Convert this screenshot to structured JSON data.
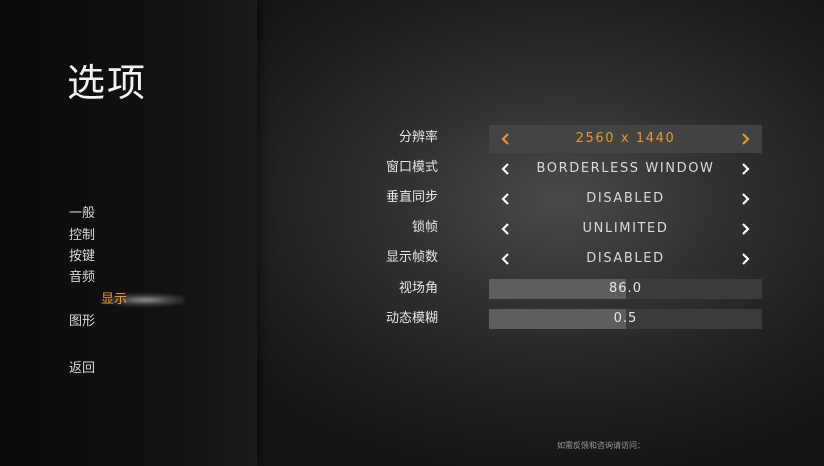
{
  "title": "选项",
  "nav": {
    "items": [
      "一般",
      "控制",
      "按键",
      "音频",
      "显示",
      "图形"
    ],
    "active": "显示",
    "back": "返回"
  },
  "settings": {
    "resolution": {
      "label": "分辨率",
      "value": "2560 x 1440"
    },
    "window_mode": {
      "label": "窗口模式",
      "value": "BORDERLESS WINDOW"
    },
    "vsync": {
      "label": "垂直同步",
      "value": "DISABLED"
    },
    "frame_lock": {
      "label": "锁帧",
      "value": "UNLIMITED"
    },
    "show_fps": {
      "label": "显示帧数",
      "value": "DISABLED"
    },
    "fov": {
      "label": "视场角",
      "value": "86.0",
      "fill": 0.5
    },
    "motion_blur": {
      "label": "动态模糊",
      "value": "0.5",
      "fill": 0.5
    }
  },
  "footer": "如需反馈和咨询请访问：",
  "colors": {
    "accent": "#e8962e",
    "text": "#e6e6e6",
    "arrow": "#ffffff"
  },
  "icons": {
    "left": "chevron-left-icon",
    "right": "chevron-right-icon"
  }
}
